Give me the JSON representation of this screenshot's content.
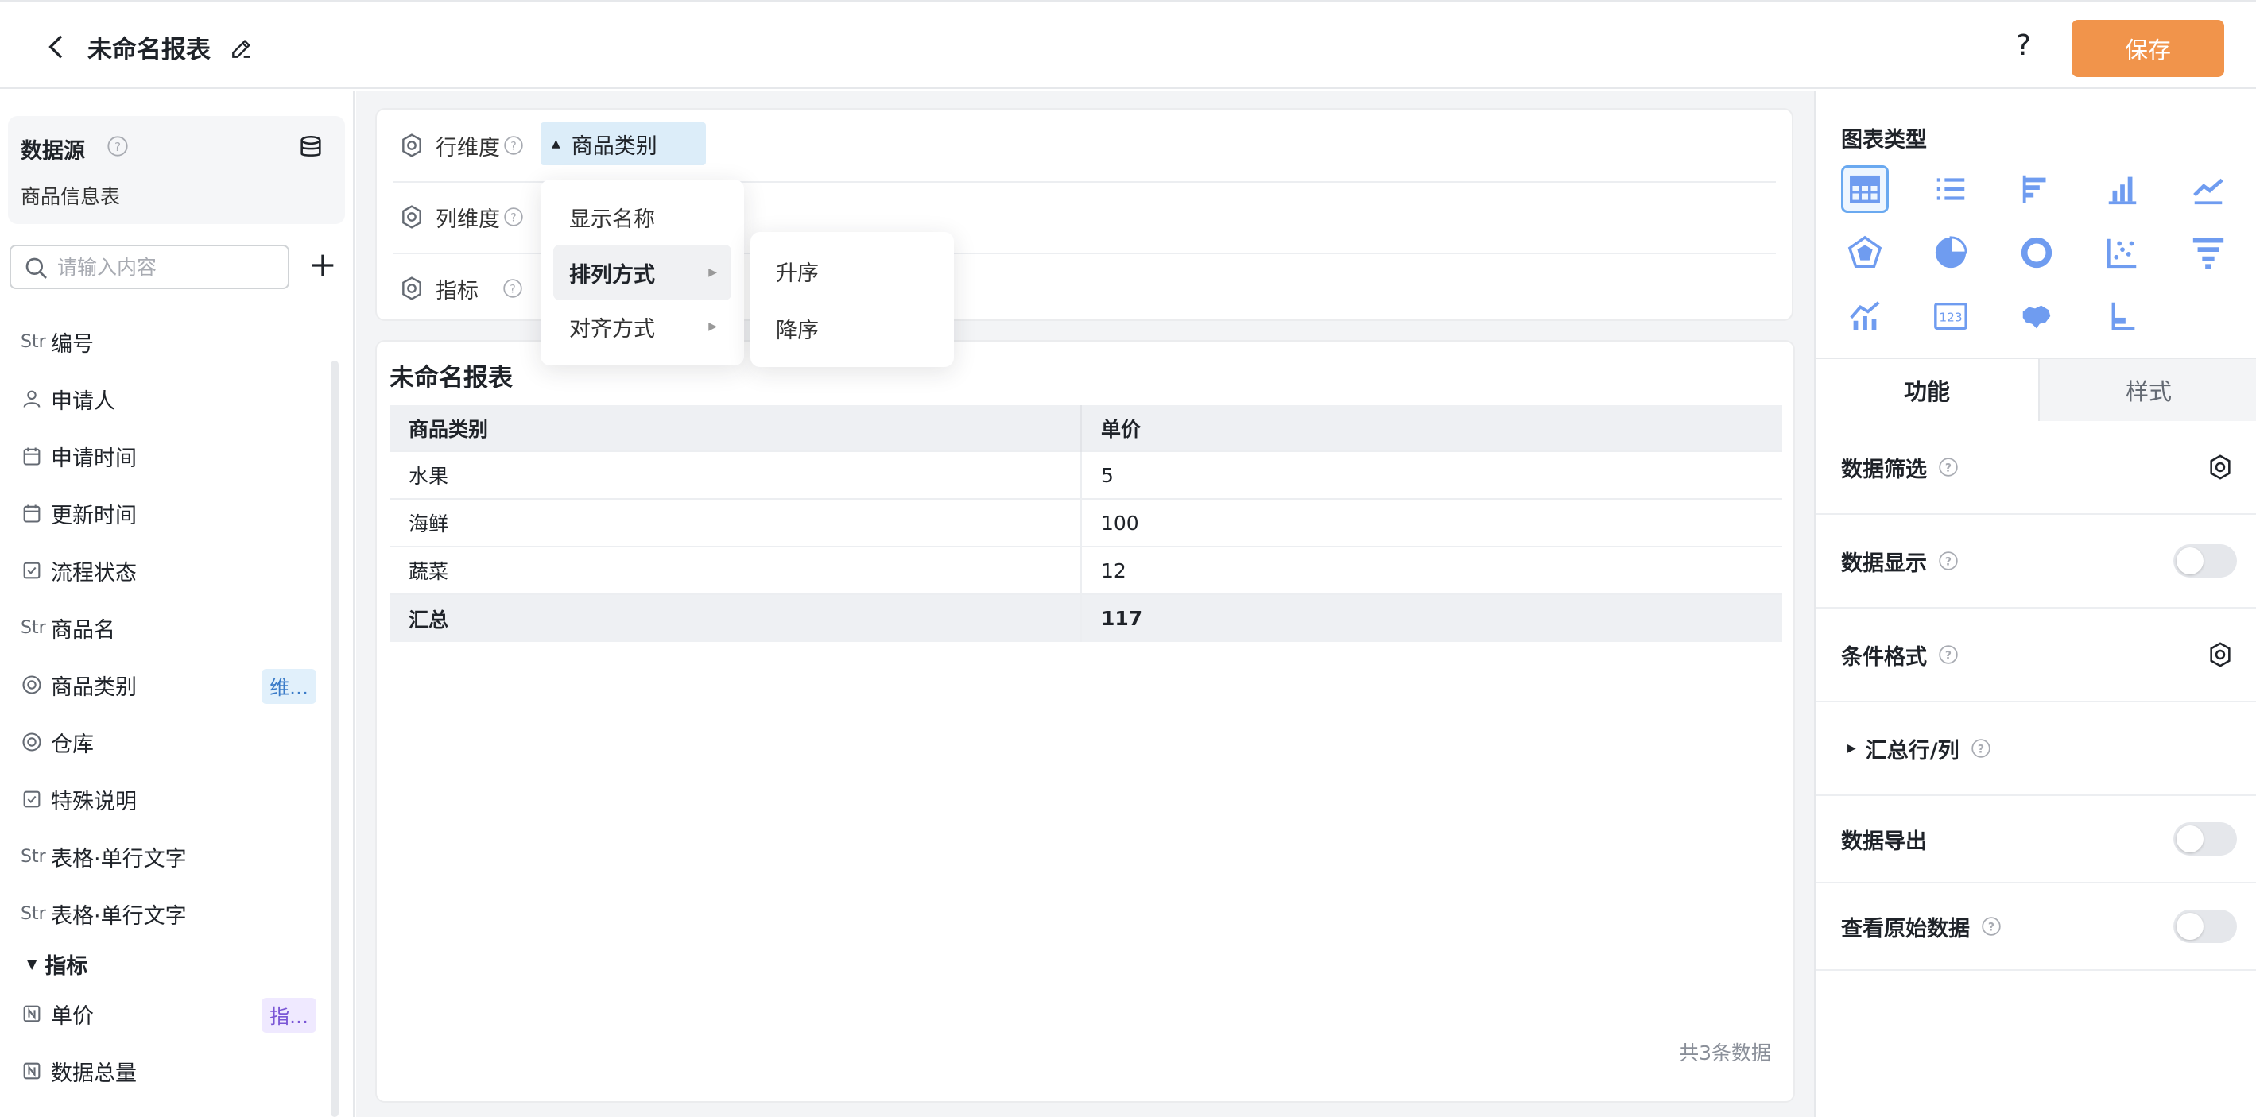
{
  "header": {
    "title": "未命名报表",
    "help": "?",
    "save_label": "保存"
  },
  "datasource": {
    "label": "数据源",
    "name": "商品信息表"
  },
  "search": {
    "placeholder": "请输入内容"
  },
  "fields": [
    {
      "icon": "Str",
      "label": "编号"
    },
    {
      "icon": "user-icon",
      "label": "申请人"
    },
    {
      "icon": "calendar-icon",
      "label": "申请时间"
    },
    {
      "icon": "calendar-icon",
      "label": "更新时间"
    },
    {
      "icon": "checkbox-icon",
      "label": "流程状态"
    },
    {
      "icon": "Str",
      "label": "商品名"
    },
    {
      "icon": "radio-icon",
      "label": "商品类别",
      "tag": "维..."
    },
    {
      "icon": "radio-icon",
      "label": "仓库"
    },
    {
      "icon": "checkbox-icon",
      "label": "特殊说明"
    },
    {
      "icon": "Str",
      "label": "表格·单行文字"
    },
    {
      "icon": "Str",
      "label": "表格·单行文字"
    }
  ],
  "metric_group": "指标",
  "metrics": [
    {
      "icon": "number-icon",
      "label": "单价",
      "tag": "指..."
    },
    {
      "icon": "number-icon",
      "label": "数据总量"
    }
  ],
  "config": {
    "row_dim_label": "行维度",
    "col_dim_label": "列维度",
    "metric_label": "指标",
    "row_dim_value": "商品类别"
  },
  "menu": {
    "items": [
      "显示名称",
      "排列方式",
      "对齐方式"
    ],
    "sort_options": [
      "升序",
      "降序"
    ]
  },
  "report": {
    "title": "未命名报表",
    "columns": [
      "商品类别",
      "单价"
    ],
    "rows": [
      [
        "水果",
        "5"
      ],
      [
        "海鲜",
        "100"
      ],
      [
        "蔬菜",
        "12"
      ]
    ],
    "total": [
      "汇总",
      "117"
    ],
    "count": "共3条数据"
  },
  "right": {
    "chart_types_label": "图表类型",
    "tabs": [
      "功能",
      "样式"
    ],
    "options": {
      "filter": "数据筛选",
      "display": "数据显示",
      "cond_format": "条件格式",
      "summary": "汇总行/列",
      "export": "数据导出",
      "raw": "查看原始数据"
    }
  },
  "colors": {
    "accent": "#f1944b",
    "chart_icon": "#6f9cf0",
    "dim_tag_bg": "#e1f0fb",
    "metric_tag_bg": "#efe9ff"
  }
}
